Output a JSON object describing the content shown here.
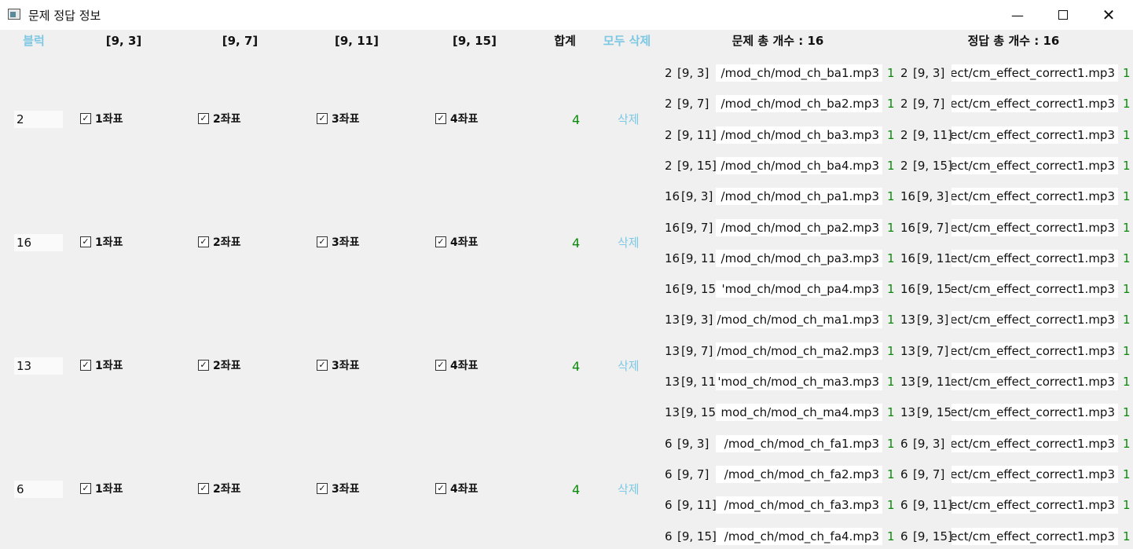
{
  "window": {
    "title": "문제 정답 정보",
    "minimize_icon": "minimize-icon",
    "maximize_icon": "maximize-icon",
    "close_icon": "close-icon"
  },
  "header": {
    "block": "블럭",
    "coord1": "[9, 3]",
    "coord2": "[9, 7]",
    "coord3": "[9, 11]",
    "coord4": "[9, 15]",
    "sum": "합계",
    "delete_all": "모두 삭제",
    "question_total": "문제 총 개수 : 16",
    "answer_total": "정답 총 개수 : 16"
  },
  "rows": [
    {
      "block": "2",
      "c1": "1좌표",
      "c2": "2좌표",
      "c3": "3좌표",
      "c4": "4좌표",
      "sum": "4",
      "delete": "삭제"
    },
    {
      "block": "16",
      "c1": "1좌표",
      "c2": "2좌표",
      "c3": "3좌표",
      "c4": "4좌표",
      "sum": "4",
      "delete": "삭제"
    },
    {
      "block": "13",
      "c1": "1좌표",
      "c2": "2좌표",
      "c3": "3좌표",
      "c4": "4좌표",
      "sum": "4",
      "delete": "삭제"
    },
    {
      "block": "6",
      "c1": "1좌표",
      "c2": "2좌표",
      "c3": "3좌표",
      "c4": "4좌표",
      "sum": "4",
      "delete": "삭제"
    }
  ],
  "questions": [
    {
      "block": "2",
      "coord": "[9, 3]",
      "file": "/mod_ch/mod_ch_ba1.mp3",
      "count": "1"
    },
    {
      "block": "2",
      "coord": "[9, 7]",
      "file": "/mod_ch/mod_ch_ba2.mp3",
      "count": "1"
    },
    {
      "block": "2",
      "coord": "[9, 11]",
      "file": "/mod_ch/mod_ch_ba3.mp3",
      "count": "1"
    },
    {
      "block": "2",
      "coord": "[9, 15]",
      "file": "/mod_ch/mod_ch_ba4.mp3",
      "count": "1"
    },
    {
      "block": "16",
      "coord": "[9, 3]",
      "file": "/mod_ch/mod_ch_pa1.mp3",
      "count": "1"
    },
    {
      "block": "16",
      "coord": "[9, 7]",
      "file": "/mod_ch/mod_ch_pa2.mp3",
      "count": "1"
    },
    {
      "block": "16",
      "coord": "[9, 11]",
      "file": "/mod_ch/mod_ch_pa3.mp3",
      "count": "1"
    },
    {
      "block": "16",
      "coord": "[9, 15]",
      "file": "'mod_ch/mod_ch_pa4.mp3",
      "count": "1"
    },
    {
      "block": "13",
      "coord": "[9, 3]",
      "file": "/mod_ch/mod_ch_ma1.mp3",
      "count": "1"
    },
    {
      "block": "13",
      "coord": "[9, 7]",
      "file": "/mod_ch/mod_ch_ma2.mp3",
      "count": "1"
    },
    {
      "block": "13",
      "coord": "[9, 11]",
      "file": "'mod_ch/mod_ch_ma3.mp3",
      "count": "1"
    },
    {
      "block": "13",
      "coord": "[9, 15]",
      "file": "mod_ch/mod_ch_ma4.mp3",
      "count": "1"
    },
    {
      "block": "6",
      "coord": "[9, 3]",
      "file": "/mod_ch/mod_ch_fa1.mp3",
      "count": "1"
    },
    {
      "block": "6",
      "coord": "[9, 7]",
      "file": "/mod_ch/mod_ch_fa2.mp3",
      "count": "1"
    },
    {
      "block": "6",
      "coord": "[9, 11]",
      "file": "/mod_ch/mod_ch_fa3.mp3",
      "count": "1"
    },
    {
      "block": "6",
      "coord": "[9, 15]",
      "file": "/mod_ch/mod_ch_fa4.mp3",
      "count": "1"
    }
  ],
  "answers": [
    {
      "block": "2",
      "coord": "[9, 3]",
      "file": "fect/cm_effect_correct1.mp3",
      "count": "1"
    },
    {
      "block": "2",
      "coord": "[9, 7]",
      "file": "fect/cm_effect_correct1.mp3",
      "count": "1"
    },
    {
      "block": "2",
      "coord": "[9, 11]",
      "file": "fect/cm_effect_correct1.mp3",
      "count": "1"
    },
    {
      "block": "2",
      "coord": "[9, 15]",
      "file": "ect/cm_effect_correct1.mp3",
      "count": "1"
    },
    {
      "block": "16",
      "coord": "[9, 3]",
      "file": "fect/cm_effect_correct1.mp3",
      "count": "1"
    },
    {
      "block": "16",
      "coord": "[9, 7]",
      "file": "fect/cm_effect_correct1.mp3",
      "count": "1"
    },
    {
      "block": "16",
      "coord": "[9, 11]",
      "file": "ect/cm_effect_correct1.mp3",
      "count": "1"
    },
    {
      "block": "16",
      "coord": "[9, 15]",
      "file": "ect/cm_effect_correct1.mp3",
      "count": "1"
    },
    {
      "block": "13",
      "coord": "[9, 3]",
      "file": "ect/cm_effect_correct1.mp3",
      "count": "1"
    },
    {
      "block": "13",
      "coord": "[9, 7]",
      "file": "ect/cm_effect_correct1.mp3",
      "count": "1"
    },
    {
      "block": "13",
      "coord": "[9, 11]",
      "file": "ect/cm_effect_correct1.mp3",
      "count": "1"
    },
    {
      "block": "13",
      "coord": "[9, 15]",
      "file": "ect/cm_effect_correct1.mp3",
      "count": "1"
    },
    {
      "block": "6",
      "coord": "[9, 3]",
      "file": "fect/cm_effect_correct1.mp3",
      "count": "1"
    },
    {
      "block": "6",
      "coord": "[9, 7]",
      "file": "fect/cm_effect_correct1.mp3",
      "count": "1"
    },
    {
      "block": "6",
      "coord": "[9, 11]",
      "file": "fect/cm_effect_correct1.mp3",
      "count": "1"
    },
    {
      "block": "6",
      "coord": "[9, 15]",
      "file": "ect/cm_effect_correct1.mp3",
      "count": "1"
    }
  ]
}
